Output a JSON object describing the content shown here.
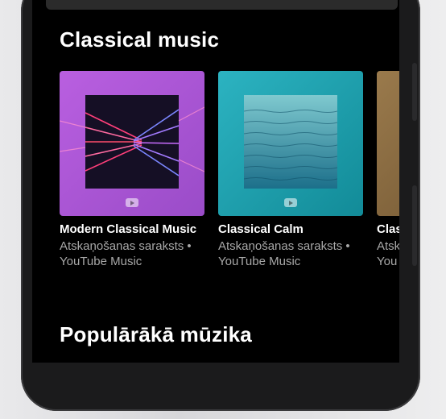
{
  "sections": {
    "classical": {
      "title": "Classical music",
      "cards": [
        {
          "title": "Modern Classical Music",
          "sub1": "Atskaņošanas saraksts •",
          "sub2": "YouTube Music"
        },
        {
          "title": "Classical Calm",
          "sub1": "Atskaņošanas saraksts •",
          "sub2": "YouTube Music"
        },
        {
          "title": "Clas",
          "sub1": "Atsk",
          "sub2": "You"
        }
      ]
    },
    "popular": {
      "title": "Populārākā mūzika"
    }
  },
  "icons": {
    "playlist_badge": "youtube-play-icon"
  },
  "colors": {
    "card1_bg": "#b05fd6",
    "card2_bg": "#1aa6b4",
    "card3_bg": "#8a6a40"
  }
}
